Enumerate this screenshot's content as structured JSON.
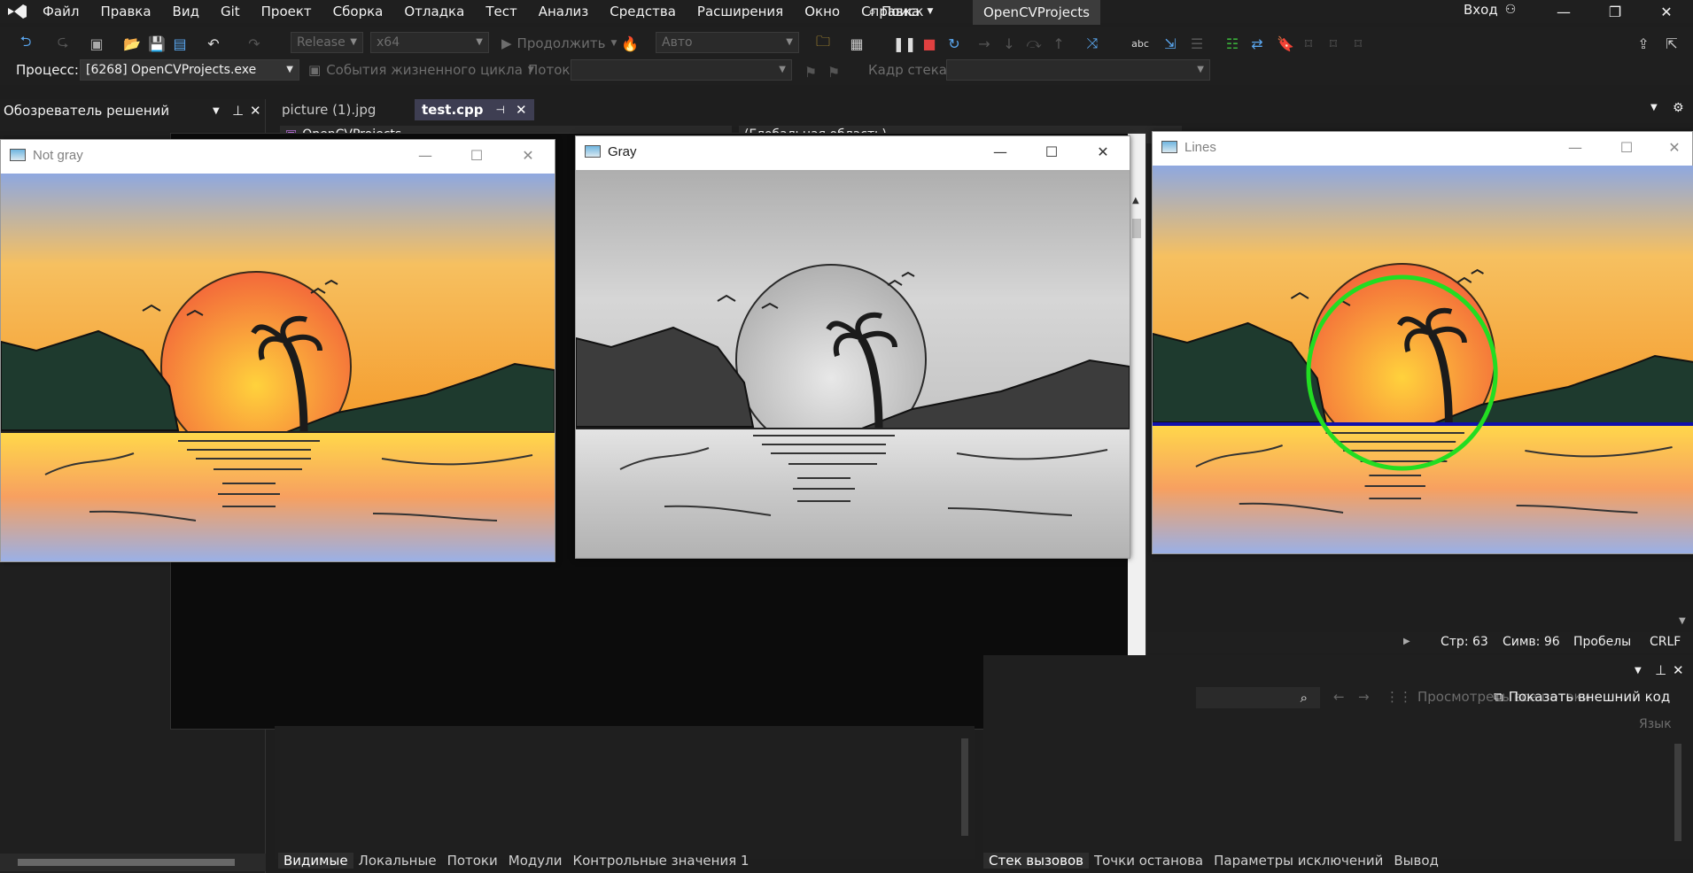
{
  "menubar": {
    "items": [
      "Файл",
      "Правка",
      "Вид",
      "Git",
      "Проект",
      "Сборка",
      "Отладка",
      "Тест",
      "Анализ",
      "Средства",
      "Расширения",
      "Окно",
      "Справка"
    ],
    "search_label": "Поиск",
    "project_name": "OpenCVProjects",
    "login_label": "Вход"
  },
  "toolbar": {
    "config": "Release",
    "platform": "x64",
    "continue_label": "Продолжить",
    "auto_label": "Авто"
  },
  "procbar": {
    "process_label": "Процесс:",
    "process_value": "[6268] OpenCVProjects.exe",
    "lifecycle_label": "События жизненного цикла",
    "thread_label": "Поток:",
    "stackframe_label": "Кадр стека:"
  },
  "solution_explorer": {
    "title": "Обозреватель решений"
  },
  "tabs": [
    {
      "label": "picture (1).jpg",
      "active": false
    },
    {
      "label": "test.cpp",
      "active": true
    }
  ],
  "editor": {
    "project_combo": "OpenCVProjects",
    "scope_combo": "(Глобальная область)"
  },
  "statusline": {
    "line": "Стр: 63",
    "col": "Симв: 96",
    "spaces": "Пробелы",
    "eol": "CRLF"
  },
  "callstack_toolbar": {
    "view_all_threads": "Просмотреть все потоки",
    "show_external": "Показать внешний код",
    "lang_col": "Язык"
  },
  "bottom_left_tabs": [
    "Видимые",
    "Локальные",
    "Потоки",
    "Модули",
    "Контрольные значения 1"
  ],
  "bottom_right_tabs": [
    "Стек вызовов",
    "Точки останова",
    "Параметры исключений",
    "Вывод"
  ],
  "cv_windows": [
    {
      "title": "Not gray",
      "kind": "color"
    },
    {
      "title": "Gray",
      "kind": "gray"
    },
    {
      "title": "Lines",
      "kind": "lines"
    }
  ],
  "colors": {
    "ide_bg": "#1e1e1e",
    "accent": "#7160e8",
    "circle_detect": "#22dd22",
    "line_detect": "#1010aa"
  }
}
